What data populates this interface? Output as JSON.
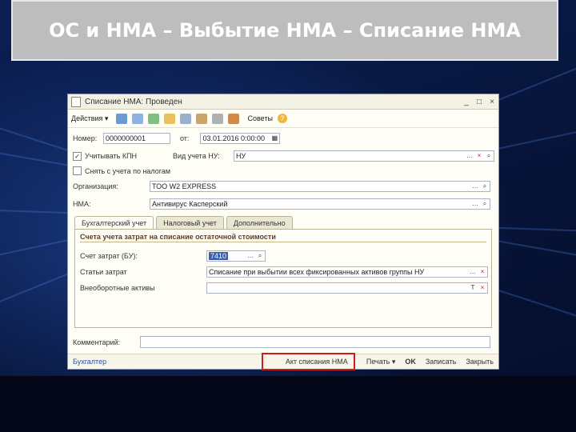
{
  "slide": {
    "title": "ОС и НМА – Выбытие НМА – Списание НМА"
  },
  "window": {
    "title": "Списание НМА: Проведен",
    "controls": [
      "_",
      "□",
      "×"
    ]
  },
  "toolbar": {
    "actions_label": "Действия ▾",
    "advice_label": "Советы",
    "help_label": "?"
  },
  "form": {
    "number_label": "Номер:",
    "number_value": "0000000001",
    "date_label": "от:",
    "date_value": "03.01.2016 0:00:00",
    "consider_kpn_label": "Учитывать КПН",
    "consider_kpn_checked": true,
    "tax_type_label": "Вид учета НУ:",
    "tax_type_value": "НУ",
    "remove_tax_label": "Снять с учета по налогам",
    "remove_tax_checked": false,
    "org_label": "Организация:",
    "org_value": "ТОО W2 EXPRESS",
    "nma_label": "НМА:",
    "nma_value": "Антивирус Касперский",
    "comment_label": "Комментарий:",
    "comment_value": ""
  },
  "tabs": [
    {
      "label": "Бухгалтерский учет",
      "active": true
    },
    {
      "label": "Налоговый учет",
      "active": false
    },
    {
      "label": "Дополнительно",
      "active": false
    }
  ],
  "accounting": {
    "section_title": "Счета учета затрат на списание остаточной стоимости",
    "account_label": "Счет затрат (БУ):",
    "account_value": "7410",
    "expense_label": "Статьи затрат",
    "expense_value": "Списание при выбытии всех фиксированных активов группы НУ",
    "noncurrent_label": "Внеоборотные активы",
    "noncurrent_value": ""
  },
  "statusbar": {
    "user": "Бухгалтер",
    "act_label": "Акт списания НМА",
    "print_label": "Печать ▾",
    "ok_label": "OK",
    "save_label": "Записать",
    "close_label": "Закрыть"
  },
  "colors": {
    "highlight": "#d11a1a",
    "background": "#0a1840"
  }
}
